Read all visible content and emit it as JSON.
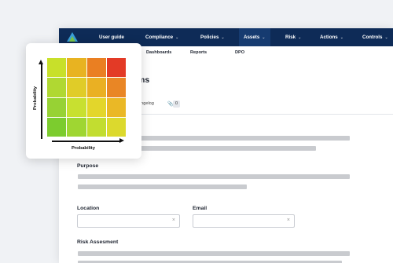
{
  "nav": {
    "items": [
      {
        "label": "User guide",
        "chevron": false
      },
      {
        "label": "Compliance",
        "chevron": true
      },
      {
        "label": "Policies",
        "chevron": true
      },
      {
        "label": "Assets",
        "chevron": true
      },
      {
        "label": "Risk",
        "chevron": true
      },
      {
        "label": "Actions",
        "chevron": true
      },
      {
        "label": "Controls",
        "chevron": true
      }
    ],
    "active": "Assets"
  },
  "subnav": [
    "Dashboards",
    "Reports",
    "DPO"
  ],
  "page": {
    "title_fragment": "ms",
    "changelog_fragment": "angelog",
    "attachment_count": "0"
  },
  "form": {
    "purpose_label": "Purpose",
    "location_label": "Location",
    "email_label": "Email",
    "risk_label": "Risk Assesment",
    "clear_glyph": "×"
  },
  "risk_matrix": {
    "x_label": "Probability",
    "y_label": "Probability",
    "colors": [
      [
        "#c8e02a",
        "#e8b321",
        "#ea7f22",
        "#e33a26"
      ],
      [
        "#b0d832",
        "#e0cc28",
        "#eab023",
        "#e98625"
      ],
      [
        "#97d234",
        "#c8e030",
        "#e3d62b",
        "#eab826"
      ],
      [
        "#7ccc2e",
        "#9fd632",
        "#c2dd30",
        "#dcd92d"
      ]
    ]
  },
  "colors": {
    "nav_bg": "#0e2b57",
    "placeholder_bar": "#c9cbcf"
  }
}
